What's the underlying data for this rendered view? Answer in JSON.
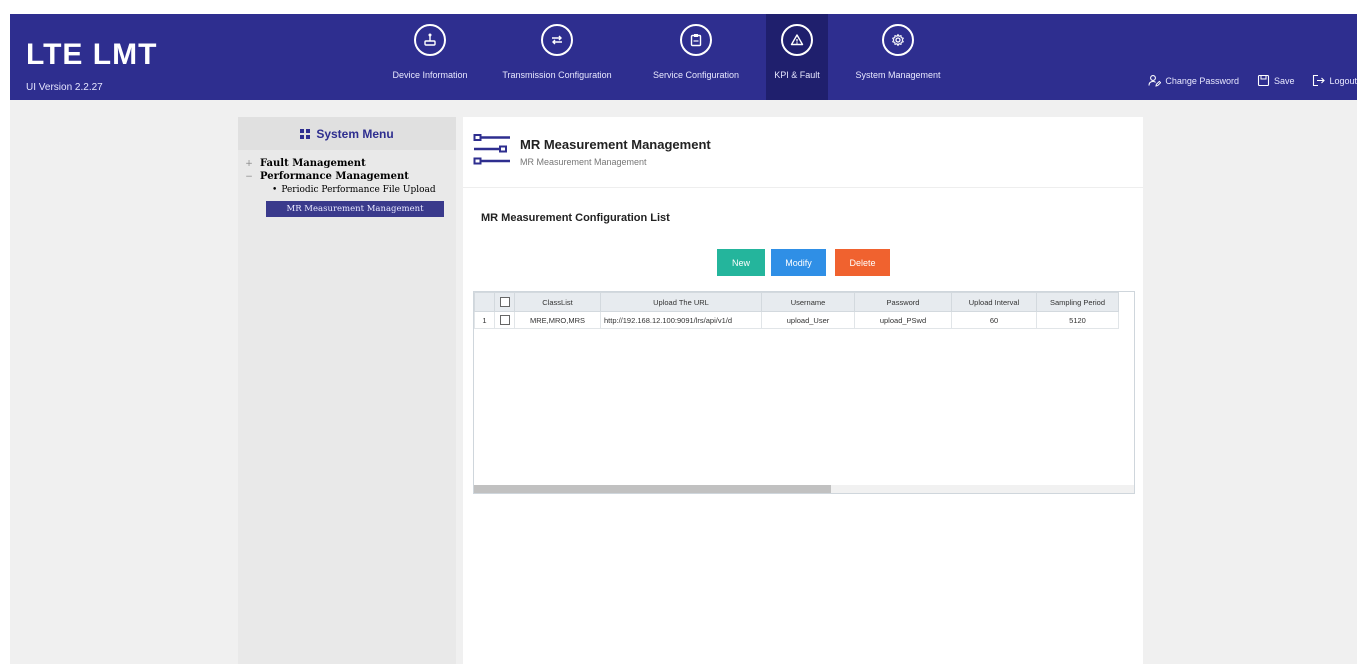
{
  "app": {
    "title": "LTE LMT",
    "version": "UI Version 2.2.27"
  },
  "nav": [
    {
      "label": "Device Information",
      "icon": "device-icon",
      "active": false
    },
    {
      "label": "Transmission Configuration",
      "icon": "transfer-arrows-icon",
      "active": false
    },
    {
      "label": "Service Configuration",
      "icon": "clipboard-icon",
      "active": false
    },
    {
      "label": "KPI & Fault",
      "icon": "warning-triangle-icon",
      "active": true
    },
    {
      "label": "System Management",
      "icon": "gear-icon",
      "active": false
    }
  ],
  "header_actions": {
    "change_password": "Change Password",
    "save": "Save",
    "logout": "Logout"
  },
  "sidebar": {
    "title": "System Menu",
    "items": [
      {
        "label": "Fault Management",
        "toggle": "+"
      },
      {
        "label": "Performance Management",
        "toggle": "−"
      }
    ],
    "sub_items": [
      {
        "label": "Periodic Performance File Upload"
      }
    ],
    "selected": "MR Measurement Management"
  },
  "content": {
    "title": "MR Measurement Management",
    "subtitle": "MR Measurement Management",
    "list_title": "MR Measurement Configuration List",
    "buttons": {
      "new": "New",
      "modify": "Modify",
      "delete": "Delete"
    }
  },
  "table": {
    "columns": [
      "ClassList",
      "Upload The URL",
      "Username",
      "Password",
      "Upload Interval",
      "Sampling Period"
    ],
    "rows": [
      {
        "index": "1",
        "cells": [
          "MRE,MRO,MRS",
          "http://192.168.12.100:9091/lrs/api/v1/d",
          "upload_User",
          "upload_PSwd",
          "60",
          "5120"
        ]
      }
    ]
  },
  "colors": {
    "header_bg": "#2e2e8f",
    "new_button": "#24b59c",
    "modify_button": "#2f8fe6",
    "delete_button": "#f0622f"
  }
}
